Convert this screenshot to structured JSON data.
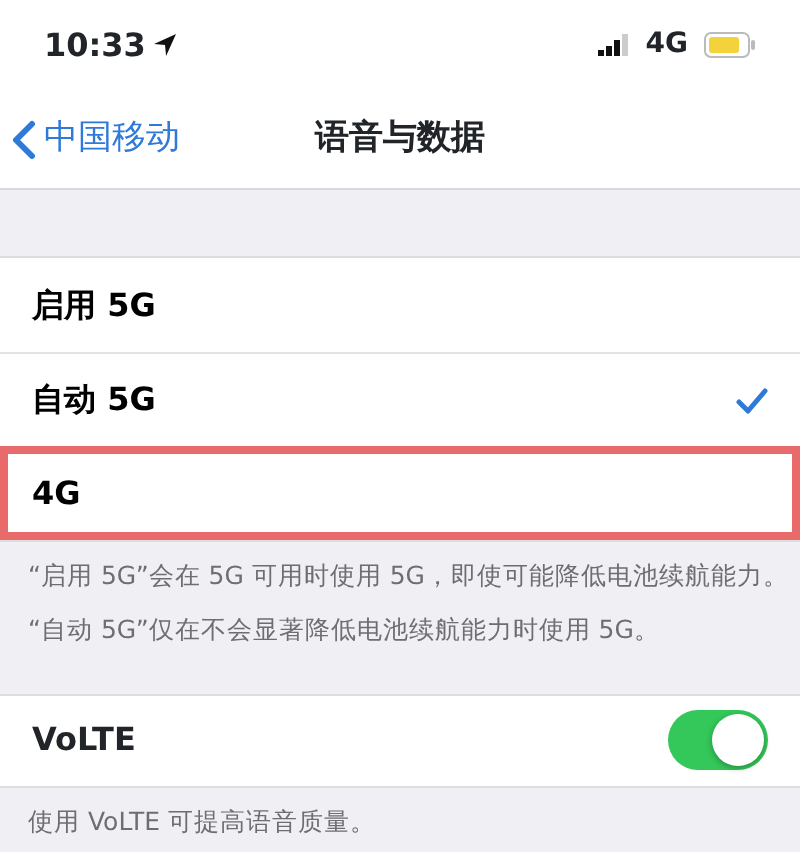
{
  "status_bar": {
    "time": "10:33",
    "network": "4G"
  },
  "nav": {
    "back_label": "中国移动",
    "title": "语音与数据"
  },
  "options": [
    {
      "label": "启用 5G",
      "selected": false,
      "highlighted": false
    },
    {
      "label": "自动 5G",
      "selected": true,
      "highlighted": false
    },
    {
      "label": "4G",
      "selected": false,
      "highlighted": true
    }
  ],
  "notes": [
    "“启用 5G”会在 5G 可用时使用 5G，即使可能降低电池续航能力。",
    "“自动 5G”仅在不会显著降低电池续航能力时使用 5G。"
  ],
  "volte": {
    "label": "VoLTE",
    "on": true
  },
  "volte_note": "使用 VoLTE 可提高语音质量。"
}
